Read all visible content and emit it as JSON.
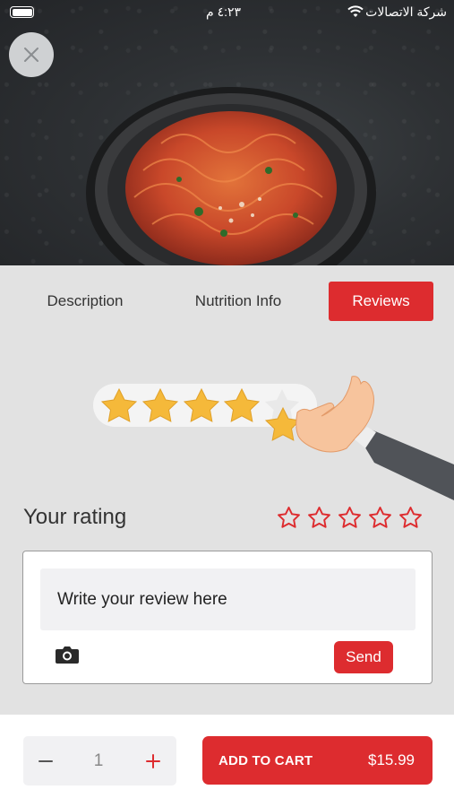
{
  "status_bar": {
    "time": "٤:٢٣ م",
    "carrier": "شركة الاتصالات",
    "battery_level": 1.0,
    "icons": [
      "battery-icon",
      "wifi-icon"
    ]
  },
  "header": {
    "close_icon": "close-icon"
  },
  "tabs": [
    {
      "label": "Description",
      "active": false
    },
    {
      "label": "Nutrition Info",
      "active": false
    },
    {
      "label": "Reviews",
      "active": true
    }
  ],
  "rating": {
    "label": "Your rating",
    "max_stars": 5,
    "selected": 0,
    "star_icon": "star-outline-icon"
  },
  "review": {
    "placeholder": "Write your review here",
    "value": "",
    "camera_icon": "camera-icon",
    "send_label": "Send"
  },
  "cart": {
    "quantity": "1",
    "minus_icon": "minus-icon",
    "plus_icon": "plus-icon",
    "add_label": "ADD TO CART",
    "price": "$15.99"
  },
  "colors": {
    "accent": "#dd2c2f",
    "star_outline": "#dd2c2f",
    "illustration_star": "#f5b93a"
  }
}
